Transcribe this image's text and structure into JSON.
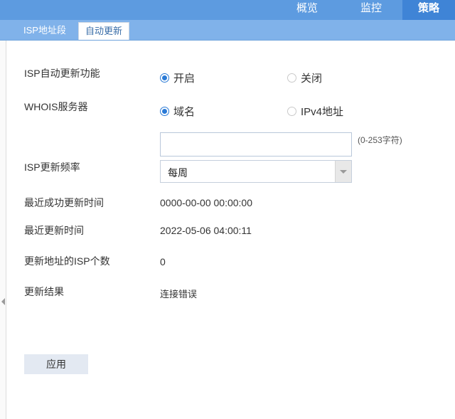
{
  "topnav": {
    "items": [
      "概览",
      "监控",
      "策略"
    ],
    "active": "策略"
  },
  "tabs": {
    "isp": "ISP地址段",
    "auto": "自动更新"
  },
  "form": {
    "auto_update": {
      "label": "ISP自动更新功能",
      "on": "开启",
      "off": "关闭",
      "selected": "开启"
    },
    "whois": {
      "label": "WHOIS服务器",
      "domain": "域名",
      "ipv4": "IPv4地址",
      "selected": "域名"
    },
    "server_input": {
      "value": "",
      "hint": "(0-253字符)"
    },
    "frequency": {
      "label": "ISP更新频率",
      "value": "每周"
    },
    "last_success": {
      "label": "最近成功更新时间",
      "value": "0000-00-00 00:00:00"
    },
    "last_update": {
      "label": "最近更新时间",
      "value": "2022-05-06 04:00:11"
    },
    "isp_count": {
      "label": "更新地址的ISP个数",
      "value": "0"
    },
    "result": {
      "label": "更新结果",
      "value": "连接错误"
    }
  },
  "apply_button": "应用",
  "colors": {
    "header": "#5d9be0",
    "tabbar": "#80b2ea",
    "active_nav": "#3f84d6",
    "radio_on": "#2a7ad6"
  }
}
